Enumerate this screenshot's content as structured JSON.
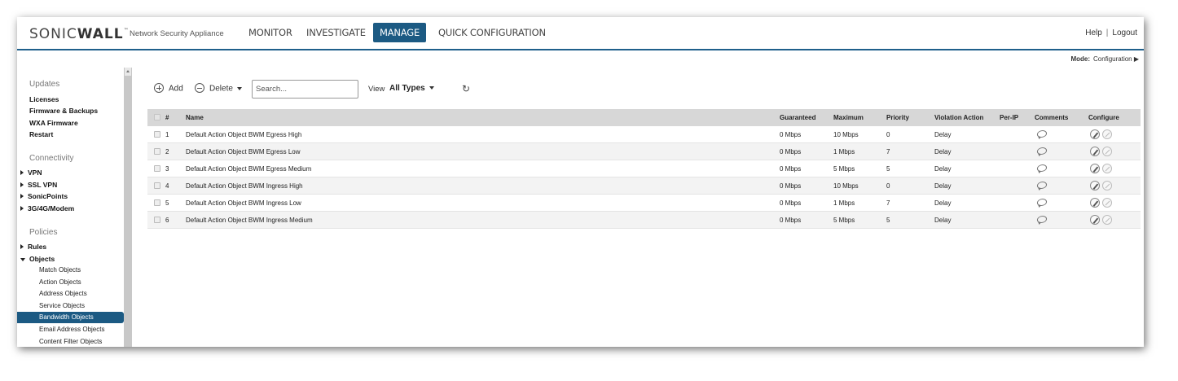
{
  "header": {
    "logo_light": "SONIC",
    "logo_bold": "WALL",
    "logo_tm": "™",
    "product": "Network Security Appliance",
    "nav": [
      {
        "label": "MONITOR"
      },
      {
        "label": "INVESTIGATE"
      },
      {
        "label": "MANAGE",
        "active": true
      },
      {
        "label": "QUICK CONFIGURATION"
      }
    ],
    "help": "Help",
    "separator": "|",
    "logout": "Logout"
  },
  "mode": {
    "label": "Mode:",
    "value": "Configuration ▶"
  },
  "sidebar": {
    "sections": [
      {
        "title": "Updates",
        "items": [
          "Licenses",
          "Firmware & Backups",
          "WXA Firmware",
          "Restart"
        ]
      },
      {
        "title": "Connectivity",
        "items": [
          "VPN",
          "SSL VPN",
          "SonicPoints",
          "3G/4G/Modem"
        ]
      },
      {
        "title": "Policies",
        "items": [
          "Rules",
          "Objects"
        ]
      }
    ],
    "object_subitems": [
      "Match Objects",
      "Action Objects",
      "Address Objects",
      "Service Objects",
      "Bandwidth Objects",
      "Email Address Objects",
      "Content Filter Objects"
    ],
    "active_subitem": "Bandwidth Objects"
  },
  "toolbar": {
    "add": "Add",
    "delete": "Delete",
    "search_placeholder": "Search...",
    "view_label": "View",
    "view_value": "All Types"
  },
  "table": {
    "columns": [
      "#",
      "Name",
      "Guaranteed",
      "Maximum",
      "Priority",
      "Violation Action",
      "Per-IP",
      "Comments",
      "Configure"
    ],
    "rows": [
      {
        "num": "1",
        "name": "Default Action Object BWM Egress High",
        "guaranteed": "0 Mbps",
        "maximum": "10 Mbps",
        "priority": "0",
        "action": "Delay"
      },
      {
        "num": "2",
        "name": "Default Action Object BWM Egress Low",
        "guaranteed": "0 Mbps",
        "maximum": "1 Mbps",
        "priority": "7",
        "action": "Delay"
      },
      {
        "num": "3",
        "name": "Default Action Object BWM Egress Medium",
        "guaranteed": "0 Mbps",
        "maximum": "5 Mbps",
        "priority": "5",
        "action": "Delay"
      },
      {
        "num": "4",
        "name": "Default Action Object BWM Ingress High",
        "guaranteed": "0 Mbps",
        "maximum": "10 Mbps",
        "priority": "0",
        "action": "Delay"
      },
      {
        "num": "5",
        "name": "Default Action Object BWM Ingress Low",
        "guaranteed": "0 Mbps",
        "maximum": "1 Mbps",
        "priority": "7",
        "action": "Delay"
      },
      {
        "num": "6",
        "name": "Default Action Object BWM Ingress Medium",
        "guaranteed": "0 Mbps",
        "maximum": "5 Mbps",
        "priority": "5",
        "action": "Delay"
      }
    ]
  }
}
